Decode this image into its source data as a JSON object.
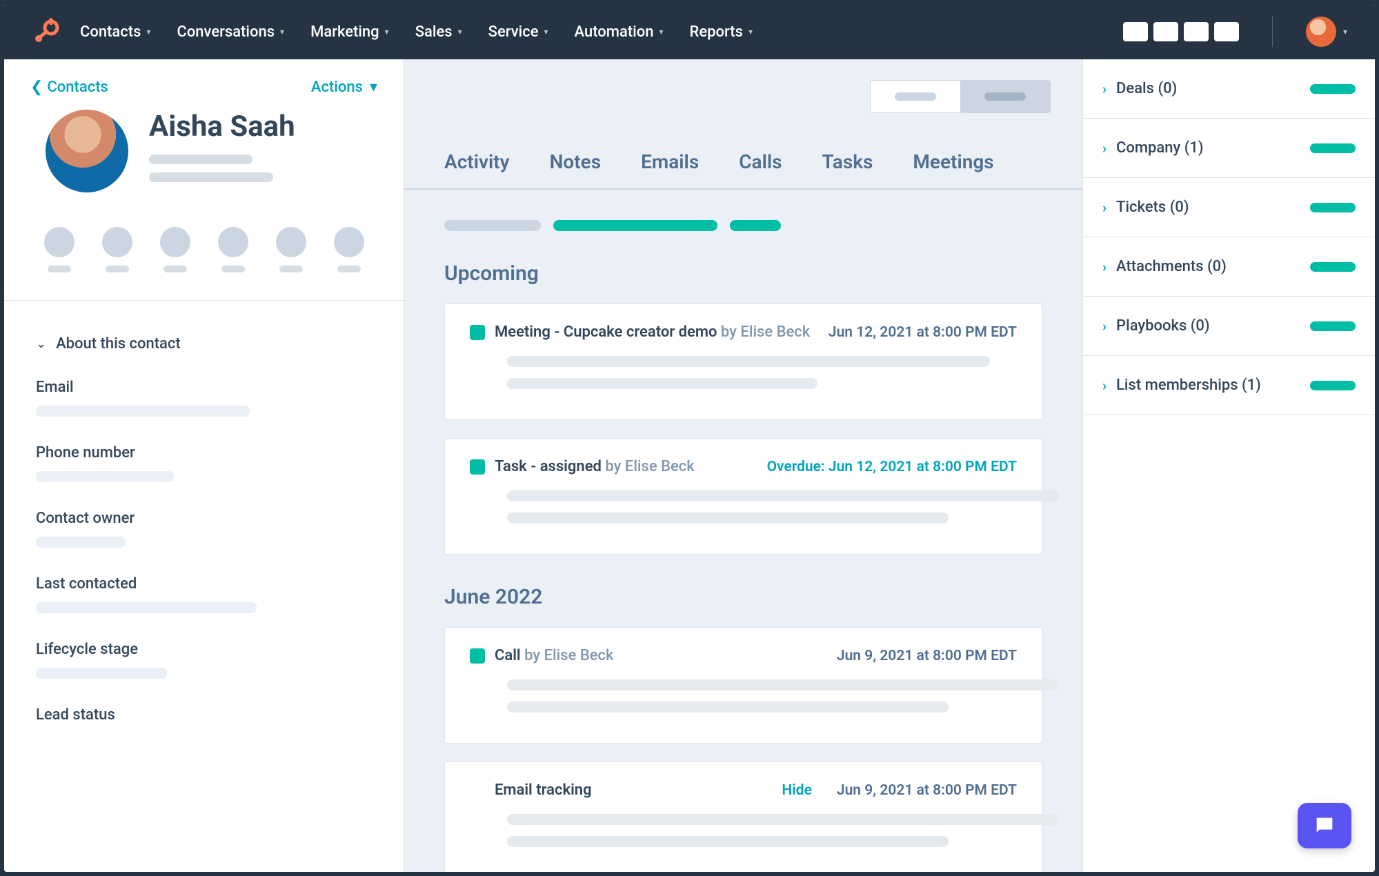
{
  "nav": {
    "items": [
      "Contacts",
      "Conversations",
      "Marketing",
      "Sales",
      "Service",
      "Automation",
      "Reports"
    ]
  },
  "left": {
    "back": "Contacts",
    "actions": "Actions",
    "name": "Aisha Saah",
    "about": "About this contact",
    "fields": {
      "email": "Email",
      "phone": "Phone number",
      "owner": "Contact owner",
      "last": "Last contacted",
      "lifecycle": "Lifecycle stage",
      "lead": "Lead status"
    }
  },
  "mid": {
    "tabs": [
      "Activity",
      "Notes",
      "Emails",
      "Calls",
      "Tasks",
      "Meetings"
    ],
    "upcoming_title": "Upcoming",
    "june_title": "June 2022",
    "items": {
      "meeting": {
        "title": "Meeting - Cupcake creator demo ",
        "by": "by Elise Beck",
        "date": "Jun 12, 2021 at 8:00 PM EDT"
      },
      "task": {
        "title": "Task - assigned ",
        "by": "by Elise Beck",
        "date": "Overdue: Jun 12, 2021 at 8:00 PM EDT"
      },
      "call": {
        "title": "Call ",
        "by": "by Elise Beck",
        "date": "Jun 9, 2021 at 8:00 PM EDT"
      },
      "email": {
        "title": "Email tracking",
        "hide": "Hide",
        "date": "Jun 9, 2021 at 8:00 PM EDT"
      }
    }
  },
  "right": {
    "deals": "Deals (0)",
    "company": "Company (1)",
    "tickets": "Tickets (0)",
    "attachments": "Attachments (0)",
    "playbooks": "Playbooks (0)",
    "lists": "List memberships (1)"
  }
}
